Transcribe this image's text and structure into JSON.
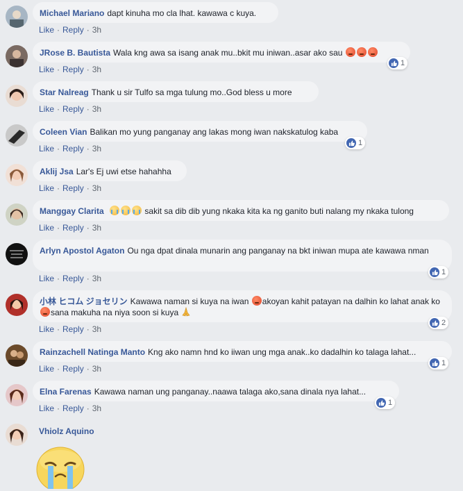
{
  "actions": {
    "like": "Like",
    "reply": "Reply",
    "separator": "·"
  },
  "comments": [
    {
      "name": "Michael Mariano",
      "text": "dapt kinuha mo cla lhat. kawawa c kuya.",
      "time": "3h",
      "reactions": ""
    },
    {
      "name": "JRose B. Bautista",
      "text": "Wala kng awa sa isang anak mu..bkit mu iniwan..asar ako sau",
      "time": "3h",
      "reactions": "1"
    },
    {
      "name": "Star Nalreag",
      "text": "Thank u sir Tulfo sa mga tulung mo..God bless u more",
      "time": "3h",
      "reactions": ""
    },
    {
      "name": "Coleen Vian",
      "text": "Balikan mo yung panganay ang lakas mong iwan nakskatulog kaba",
      "time": "3h",
      "reactions": "1"
    },
    {
      "name": "Aklij Jsa",
      "text": "Lar's Ej uwi etse hahahha",
      "time": "3h",
      "reactions": ""
    },
    {
      "name": "Manggay Clarita",
      "text": "sakit sa dib dib yung nkaka kita ka ng ganito buti nalang my nkaka tulong",
      "time": "3h",
      "reactions": ""
    },
    {
      "name": "Arlyn Apostol Agaton",
      "text": "Ou nga dpat dinala munarin ang panganay na bkt iniwan mupa ate kawawa nman",
      "time": "3h",
      "reactions": "1"
    },
    {
      "name": "小林 ヒコム ジョセリン",
      "text_a": "Kawawa naman si kuya na iwan",
      "text_b": "akoyan kahit patayan na dalhin ko lahat anak ko",
      "text_c": "sana makuha na niya soon si kuya",
      "time": "3h",
      "reactions": "2"
    },
    {
      "name": "Rainzachell Natinga Manto",
      "text": "Kng ako namn hnd ko iiwan ung mga anak..ko dadalhin ko talaga lahat...",
      "time": "3h",
      "reactions": "1"
    },
    {
      "name": "Elna Farenas",
      "text": "Kawawa naman ung panganay..naawa talaga ako,sana dinala nya lahat...",
      "time": "3h",
      "reactions": "1"
    },
    {
      "name": "Vhiolz Aquino",
      "text": "",
      "time": "",
      "reactions": ""
    }
  ],
  "colors": {
    "name": "#385898",
    "bubble": "#f2f3f5",
    "page": "#e9ebee",
    "like": "#4267b2",
    "angry": "#e0462b",
    "cry": "#f2b53c"
  },
  "icons": [
    "like-icon",
    "angry-emoji",
    "crying-emoji",
    "praying-hands-emoji",
    "big-crying-sticker"
  ]
}
